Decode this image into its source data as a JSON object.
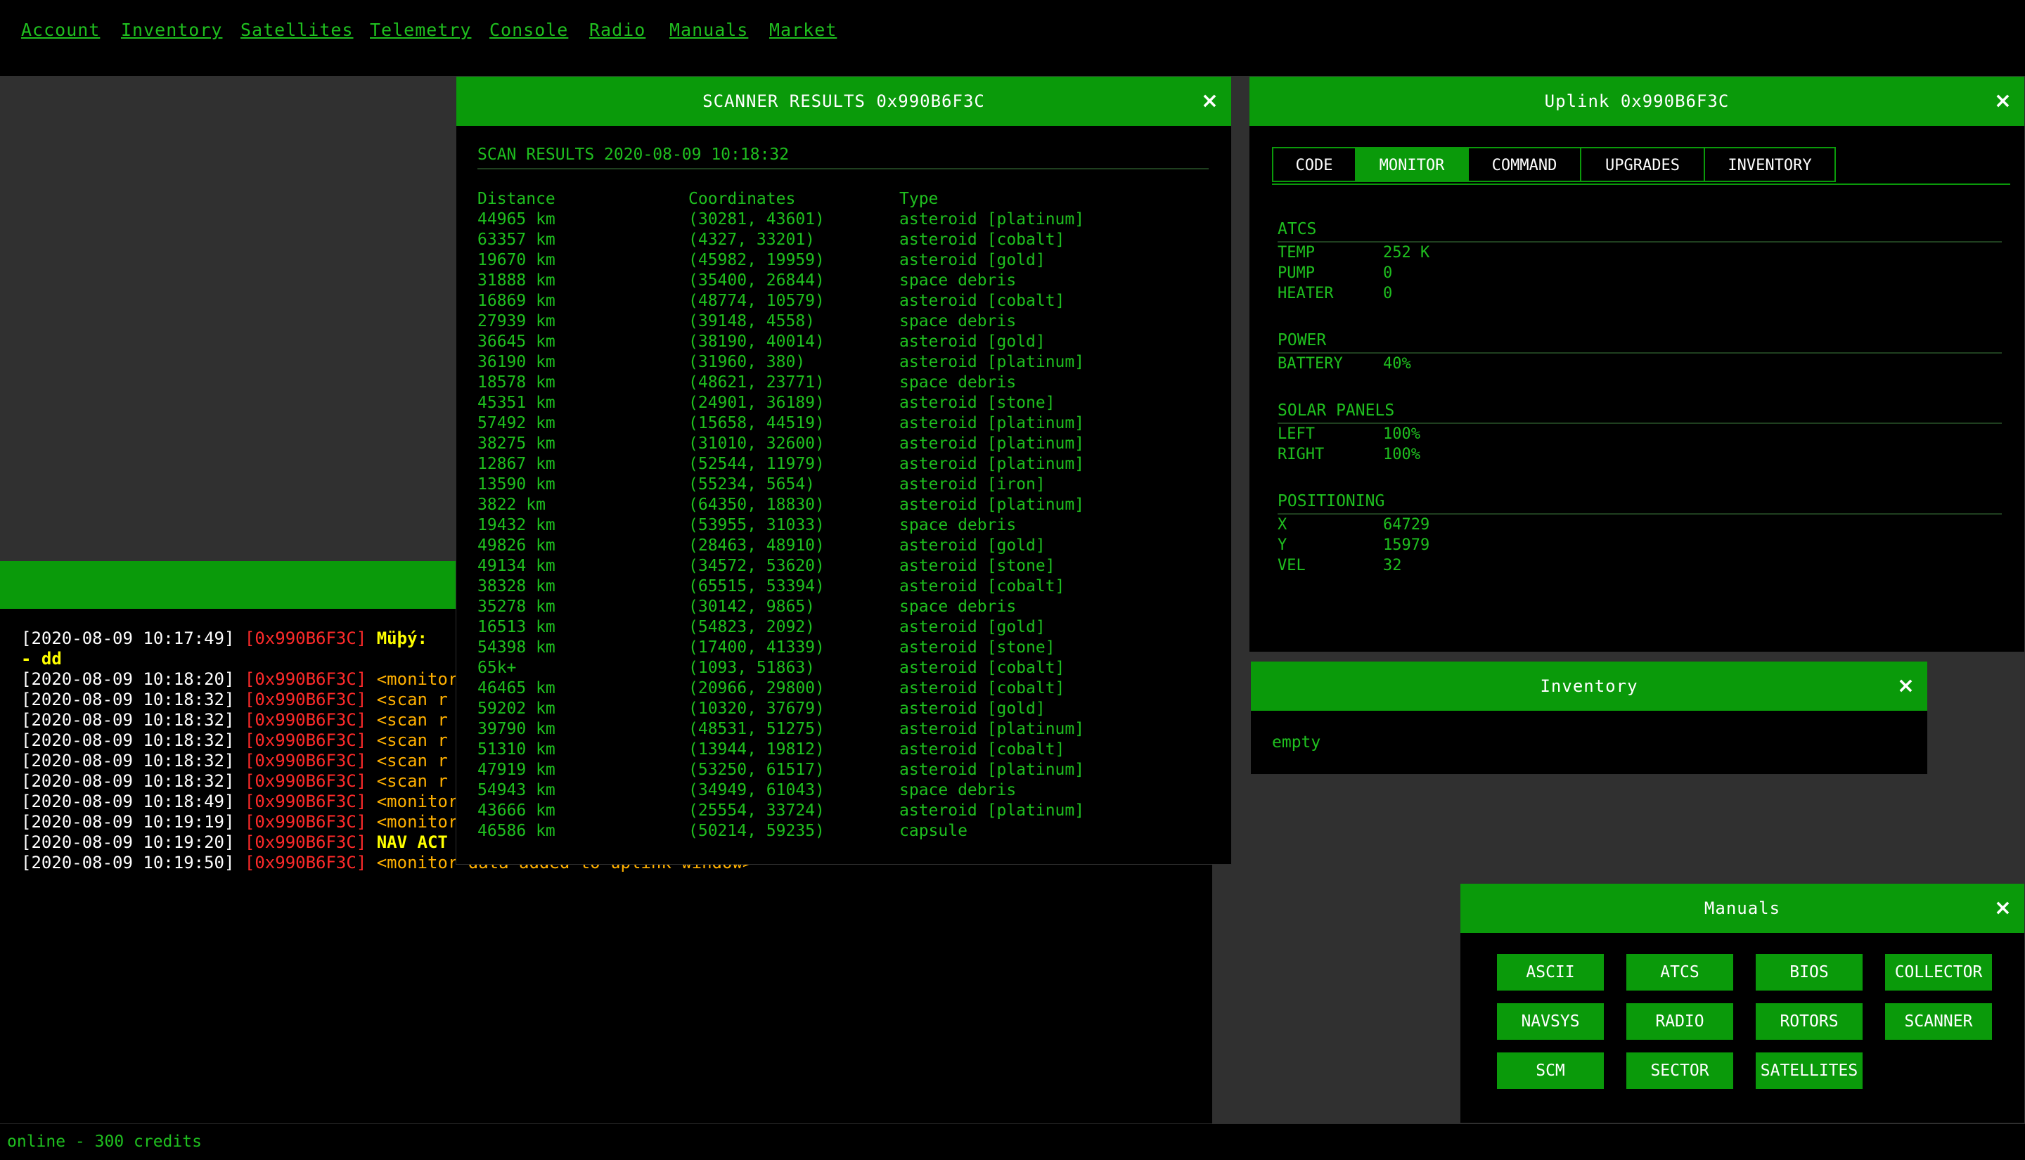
{
  "nav": {
    "items": [
      "Account",
      "Inventory",
      "Satellites",
      "Telemetry",
      "Console",
      "Radio",
      "Manuals",
      "Market"
    ]
  },
  "scanner": {
    "title": "SCANNER RESULTS 0x990B6F3C",
    "close": "×",
    "header": "SCAN RESULTS 2020-08-09 10:18:32",
    "columns": [
      "Distance",
      "Coordinates",
      "Type"
    ],
    "rows": [
      [
        "44965 km",
        "(30281, 43601)",
        "asteroid [platinum]"
      ],
      [
        "63357 km",
        "(4327, 33201)",
        "asteroid [cobalt]"
      ],
      [
        "19670 km",
        "(45982, 19959)",
        "asteroid [gold]"
      ],
      [
        "31888 km",
        "(35400, 26844)",
        "space debris"
      ],
      [
        "16869 km",
        "(48774, 10579)",
        "asteroid [cobalt]"
      ],
      [
        "27939 km",
        "(39148, 4558)",
        "space debris"
      ],
      [
        "36645 km",
        "(38190, 40014)",
        "asteroid [gold]"
      ],
      [
        "36190 km",
        "(31960, 380)",
        "asteroid [platinum]"
      ],
      [
        "18578 km",
        "(48621, 23771)",
        "space debris"
      ],
      [
        "45351 km",
        "(24901, 36189)",
        "asteroid [stone]"
      ],
      [
        "57492 km",
        "(15658, 44519)",
        "asteroid [platinum]"
      ],
      [
        "38275 km",
        "(31010, 32600)",
        "asteroid [platinum]"
      ],
      [
        "12867 km",
        "(52544, 11979)",
        "asteroid [platinum]"
      ],
      [
        "13590 km",
        "(55234, 5654)",
        "asteroid [iron]"
      ],
      [
        "3822 km",
        "(64350, 18830)",
        "asteroid [platinum]"
      ],
      [
        "19432 km",
        "(53955, 31033)",
        "space debris"
      ],
      [
        "49826 km",
        "(28463, 48910)",
        "asteroid [gold]"
      ],
      [
        "49134 km",
        "(34572, 53620)",
        "asteroid [stone]"
      ],
      [
        "38328 km",
        "(65515, 53394)",
        "asteroid [cobalt]"
      ],
      [
        "35278 km",
        "(30142, 9865)",
        "space debris"
      ],
      [
        "16513 km",
        "(54823, 2092)",
        "asteroid [gold]"
      ],
      [
        "54398 km",
        "(17400, 41339)",
        "asteroid [stone]"
      ],
      [
        "65k+",
        "(1093, 51863)",
        "asteroid [cobalt]"
      ],
      [
        "46465 km",
        "(20966, 29800)",
        "asteroid [cobalt]"
      ],
      [
        "59202 km",
        "(10320, 37679)",
        "asteroid [gold]"
      ],
      [
        "39790 km",
        "(48531, 51275)",
        "asteroid [platinum]"
      ],
      [
        "51310 km",
        "(13944, 19812)",
        "asteroid [cobalt]"
      ],
      [
        "47919 km",
        "(53250, 61517)",
        "asteroid [platinum]"
      ],
      [
        "54943 km",
        "(34949, 61043)",
        "space debris"
      ],
      [
        "43666 km",
        "(25554, 33724)",
        "asteroid [platinum]"
      ],
      [
        "46586 km",
        "(50214, 59235)",
        "capsule"
      ]
    ]
  },
  "console": {
    "lines": [
      {
        "ts": "[2020-08-09 10:17:49]",
        "id": "[0x990B6F3C]",
        "msg": "Müþý:",
        "style": "yellow"
      },
      {
        "ts": "",
        "id": "",
        "msg": "- dd",
        "style": "yellow"
      },
      {
        "ts": "[2020-08-09 10:18:20]",
        "id": "[0x990B6F3C]",
        "msg": "<monitor",
        "style": "orange"
      },
      {
        "ts": "[2020-08-09 10:18:32]",
        "id": "[0x990B6F3C]",
        "msg": "<scan r",
        "style": "orange"
      },
      {
        "ts": "[2020-08-09 10:18:32]",
        "id": "[0x990B6F3C]",
        "msg": "<scan r",
        "style": "orange"
      },
      {
        "ts": "[2020-08-09 10:18:32]",
        "id": "[0x990B6F3C]",
        "msg": "<scan r",
        "style": "orange"
      },
      {
        "ts": "[2020-08-09 10:18:32]",
        "id": "[0x990B6F3C]",
        "msg": "<scan r",
        "style": "orange"
      },
      {
        "ts": "[2020-08-09 10:18:32]",
        "id": "[0x990B6F3C]",
        "msg": "<scan r",
        "style": "orange"
      },
      {
        "ts": "[2020-08-09 10:18:49]",
        "id": "[0x990B6F3C]",
        "msg": "<monitor",
        "style": "orange"
      },
      {
        "ts": "[2020-08-09 10:19:19]",
        "id": "[0x990B6F3C]",
        "msg": "<monitor",
        "style": "orange"
      },
      {
        "ts": "[2020-08-09 10:19:20]",
        "id": "[0x990B6F3C]",
        "msg": "NAV ACT",
        "style": "yellow"
      },
      {
        "ts": "[2020-08-09 10:19:50]",
        "id": "[0x990B6F3C]",
        "msg": "<monitor data added to uplink window>",
        "style": "orange"
      }
    ]
  },
  "uplink": {
    "title": "Uplink 0x990B6F3C",
    "close": "×",
    "tabs": [
      "CODE",
      "MONITOR",
      "COMMAND",
      "UPGRADES",
      "INVENTORY"
    ],
    "active_tab": "MONITOR",
    "sections": {
      "atcs": {
        "heading": "ATCS",
        "rows": [
          [
            "TEMP",
            "252 K"
          ],
          [
            "PUMP",
            "0"
          ],
          [
            "HEATER",
            "0"
          ]
        ]
      },
      "power": {
        "heading": "POWER",
        "rows": [
          [
            "BATTERY",
            "40%"
          ]
        ]
      },
      "solar": {
        "heading": "SOLAR PANELS",
        "rows": [
          [
            "LEFT",
            "100%"
          ],
          [
            "RIGHT",
            "100%"
          ]
        ]
      },
      "positioning": {
        "heading": "POSITIONING",
        "rows": [
          [
            "X",
            "64729"
          ],
          [
            "Y",
            "15979"
          ],
          [
            "VEL",
            "32"
          ]
        ]
      }
    }
  },
  "inventory": {
    "title": "Inventory",
    "close": "×",
    "empty_text": "empty"
  },
  "manuals": {
    "title": "Manuals",
    "close": "×",
    "buttons": [
      "ASCII",
      "ATCS",
      "BIOS",
      "COLLECTOR",
      "NAVSYS",
      "RADIO",
      "ROTORS",
      "SCANNER",
      "SCM",
      "SECTOR",
      "SATELLITES"
    ]
  },
  "status": {
    "text": "online - 300 credits"
  }
}
